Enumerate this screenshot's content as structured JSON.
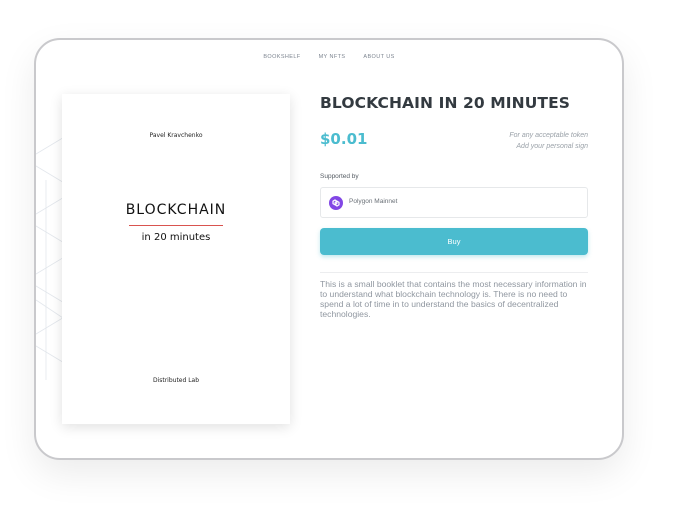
{
  "nav": {
    "items": [
      {
        "label": "BOOKSHELF"
      },
      {
        "label": "MY NFTS"
      },
      {
        "label": "ABOUT US"
      }
    ]
  },
  "cover": {
    "author": "Pavel Kravchenko",
    "title": "BLOCKCHAIN",
    "subtitle": "in 20 minutes",
    "publisher": "Distributed Lab"
  },
  "product": {
    "title": "BLOCKCHAIN IN 20 MINUTES",
    "price": "$0.01",
    "token_note_line1": "For any acceptable token",
    "token_note_line2": "Add your personal sign",
    "supported_label": "Supported by",
    "network": "Polygon Mainnet",
    "buy_label": "Buy",
    "description": "This is a small booklet that contains the most necessary information in to understand what blockchain technology is. There is no need to spend a lot of time in to understand the basics of decentralized technologies."
  },
  "colors": {
    "accent": "#4bbccf",
    "polygon": "#8247e5",
    "cover_rule": "#d9534f"
  },
  "icons": {
    "network": "polygon-logo-icon"
  }
}
